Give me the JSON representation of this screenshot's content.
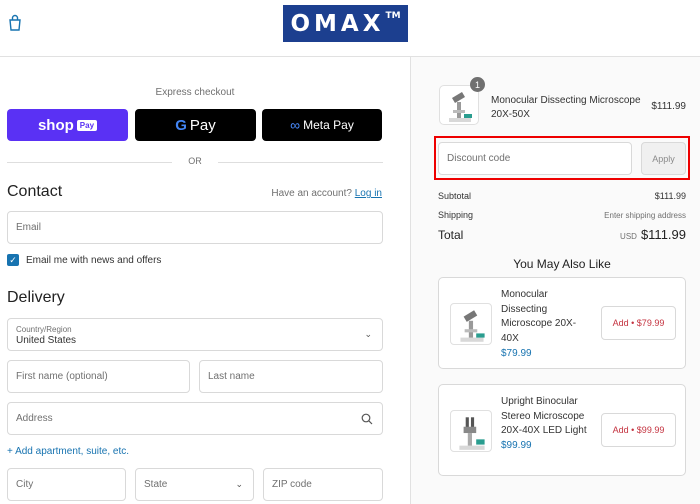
{
  "header": {
    "logo_text": "OMAX",
    "logo_mark": "TM",
    "cart_icon": "shopping-bag-icon"
  },
  "express": {
    "title": "Express checkout",
    "shop_pay": {
      "word": "shop",
      "badge": "Pay"
    },
    "google_pay": {
      "g": "G",
      "word": "Pay"
    },
    "meta_pay": {
      "mark": "∞",
      "word": "Meta Pay"
    },
    "divider": "OR"
  },
  "contact": {
    "heading": "Contact",
    "have_account": "Have an account?",
    "login": "Log in",
    "email_placeholder": "Email",
    "newsletter_label": "Email me with news and offers",
    "newsletter_checked": true
  },
  "delivery": {
    "heading": "Delivery",
    "country_label": "Country/Region",
    "country_value": "United States",
    "first_name_placeholder": "First name (optional)",
    "last_name_placeholder": "Last name",
    "address_placeholder": "Address",
    "add_apartment": "+ Add apartment, suite, etc.",
    "city_placeholder": "City",
    "state_placeholder": "State",
    "zip_placeholder": "ZIP code"
  },
  "order": {
    "item": {
      "quantity": "1",
      "name": "Monocular Dissecting Microscope 20X-50X",
      "price": "$111.99"
    },
    "discount_placeholder": "Discount code",
    "apply_label": "Apply",
    "subtotal_label": "Subtotal",
    "subtotal_value": "$111.99",
    "shipping_label": "Shipping",
    "shipping_value": "Enter shipping address",
    "total_label": "Total",
    "total_currency": "USD",
    "total_value": "$111.99"
  },
  "recommendations": {
    "heading": "You May Also Like",
    "items": [
      {
        "name": "Monocular Dissecting Microscope 20X-40X",
        "price": "$79.99",
        "button": "Add • $79.99"
      },
      {
        "name": "Upright Binocular Stereo Microscope 20X-40X LED Light",
        "price": "$99.99",
        "button": "Add • $99.99"
      }
    ]
  },
  "colors": {
    "brand": "#1c3f8f",
    "shop_pay": "#5a31f4",
    "link": "#1773b0",
    "add_button_text": "#c4323f",
    "highlight": "#ee0000"
  }
}
